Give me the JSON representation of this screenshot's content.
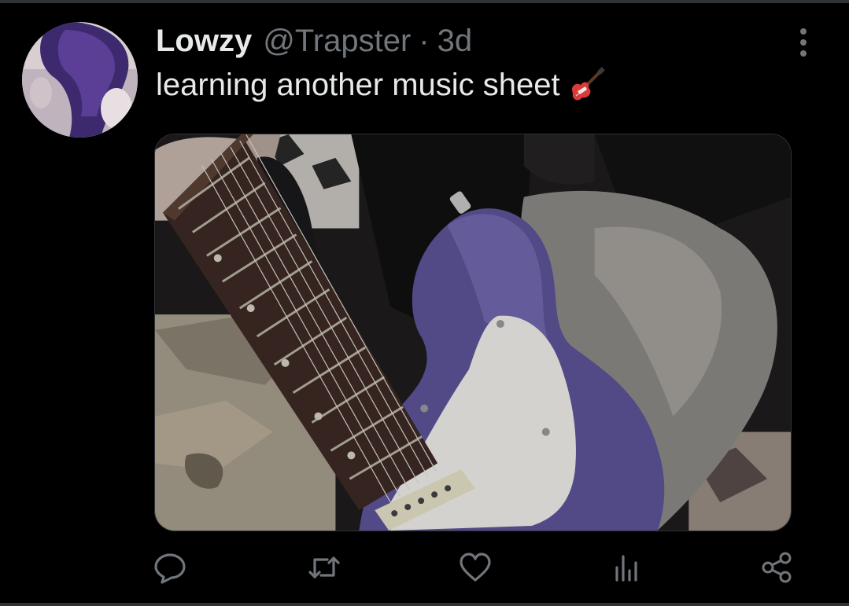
{
  "tweet": {
    "display_name": "Lowzy",
    "handle": "@Trapster",
    "separator": "·",
    "time": "3d",
    "text": "learning another music sheet",
    "emoji": "guitar-emoji"
  },
  "media": {
    "alt": "",
    "subject": "purple-electric-guitar-photo"
  },
  "actions": [
    {
      "name": "reply",
      "icon": "reply-icon"
    },
    {
      "name": "retweet",
      "icon": "retweet-icon"
    },
    {
      "name": "like",
      "icon": "heart-icon"
    },
    {
      "name": "analytics",
      "icon": "analytics-icon"
    },
    {
      "name": "share",
      "icon": "share-icon"
    }
  ],
  "colors": {
    "background": "#000000",
    "primary_text": "#e7e9ea",
    "secondary_text": "#71767b",
    "border": "#2f3336",
    "guitar_purple": "#5e549a"
  }
}
